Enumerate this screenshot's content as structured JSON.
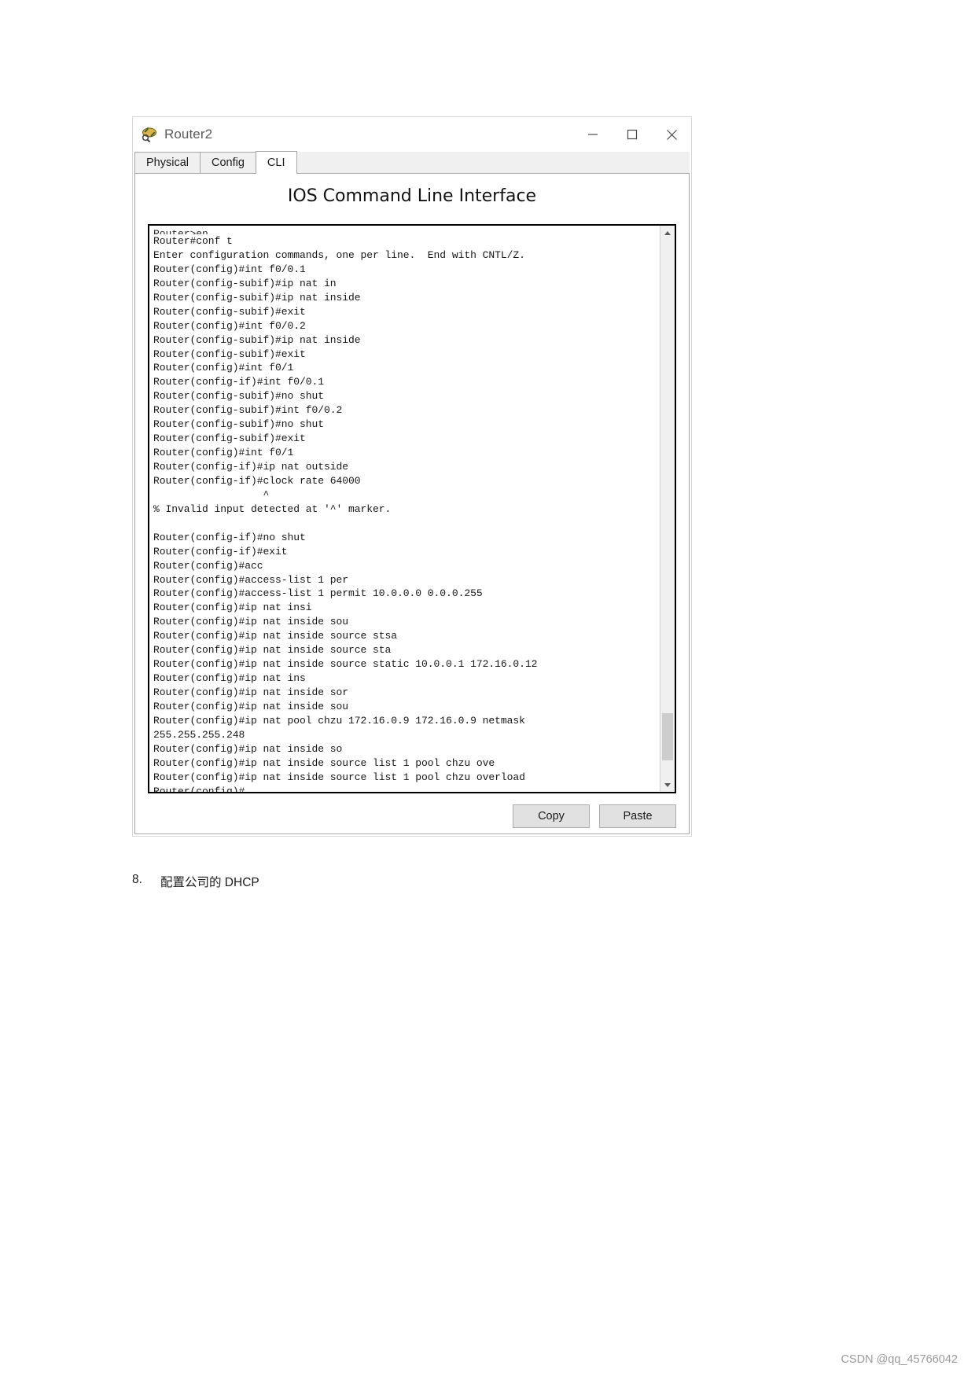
{
  "window": {
    "title": "Router2",
    "icon": "router-app-icon",
    "controls": {
      "minimize": "minimize-icon",
      "maximize": "maximize-icon",
      "close": "close-icon"
    }
  },
  "tabs": [
    {
      "label": "Physical",
      "active": false
    },
    {
      "label": "Config",
      "active": false
    },
    {
      "label": "CLI",
      "active": true
    }
  ],
  "panel": {
    "heading": "IOS Command Line Interface"
  },
  "terminal": {
    "clipped_top_line": "Router>en",
    "lines": [
      "Router#conf t",
      "Enter configuration commands, one per line.  End with CNTL/Z.",
      "Router(config)#int f0/0.1",
      "Router(config-subif)#ip nat in",
      "Router(config-subif)#ip nat inside",
      "Router(config-subif)#exit",
      "Router(config)#int f0/0.2",
      "Router(config-subif)#ip nat inside",
      "Router(config-subif)#exit",
      "Router(config)#int f0/1",
      "Router(config-if)#int f0/0.1",
      "Router(config-subif)#no shut",
      "Router(config-subif)#int f0/0.2",
      "Router(config-subif)#no shut",
      "Router(config-subif)#exit",
      "Router(config)#int f0/1",
      "Router(config-if)#ip nat outside",
      "Router(config-if)#clock rate 64000",
      "                  ^",
      "% Invalid input detected at '^' marker.",
      "",
      "Router(config-if)#no shut",
      "Router(config-if)#exit",
      "Router(config)#acc",
      "Router(config)#access-list 1 per",
      "Router(config)#access-list 1 permit 10.0.0.0 0.0.0.255",
      "Router(config)#ip nat insi",
      "Router(config)#ip nat inside sou",
      "Router(config)#ip nat inside source stsa",
      "Router(config)#ip nat inside source sta",
      "Router(config)#ip nat inside source static 10.0.0.1 172.16.0.12",
      "Router(config)#ip nat ins",
      "Router(config)#ip nat inside sor",
      "Router(config)#ip nat inside sou",
      "Router(config)#ip nat pool chzu 172.16.0.9 172.16.0.9 netmask",
      "255.255.255.248",
      "Router(config)#ip nat inside so",
      "Router(config)#ip nat inside source list 1 pool chzu ove",
      "Router(config)#ip nat inside source list 1 pool chzu overload",
      "Router(config)#"
    ],
    "scrollbar": {
      "up_arrow": "chevron-up-icon",
      "down_arrow": "chevron-down-icon"
    }
  },
  "footer": {
    "copy_label": "Copy",
    "paste_label": "Paste"
  },
  "document": {
    "caption_number": "8.",
    "caption_text": "配置公司的 DHCP"
  },
  "watermark": "CSDN @qq_45766042",
  "colors": {
    "window_border": "#d7d7d7",
    "tab_border": "#a6a6a6",
    "terminal_border": "#000000",
    "button_face": "#e1e1e1",
    "title_text": "#5a5a5a",
    "watermark": "#9a9a9a"
  }
}
